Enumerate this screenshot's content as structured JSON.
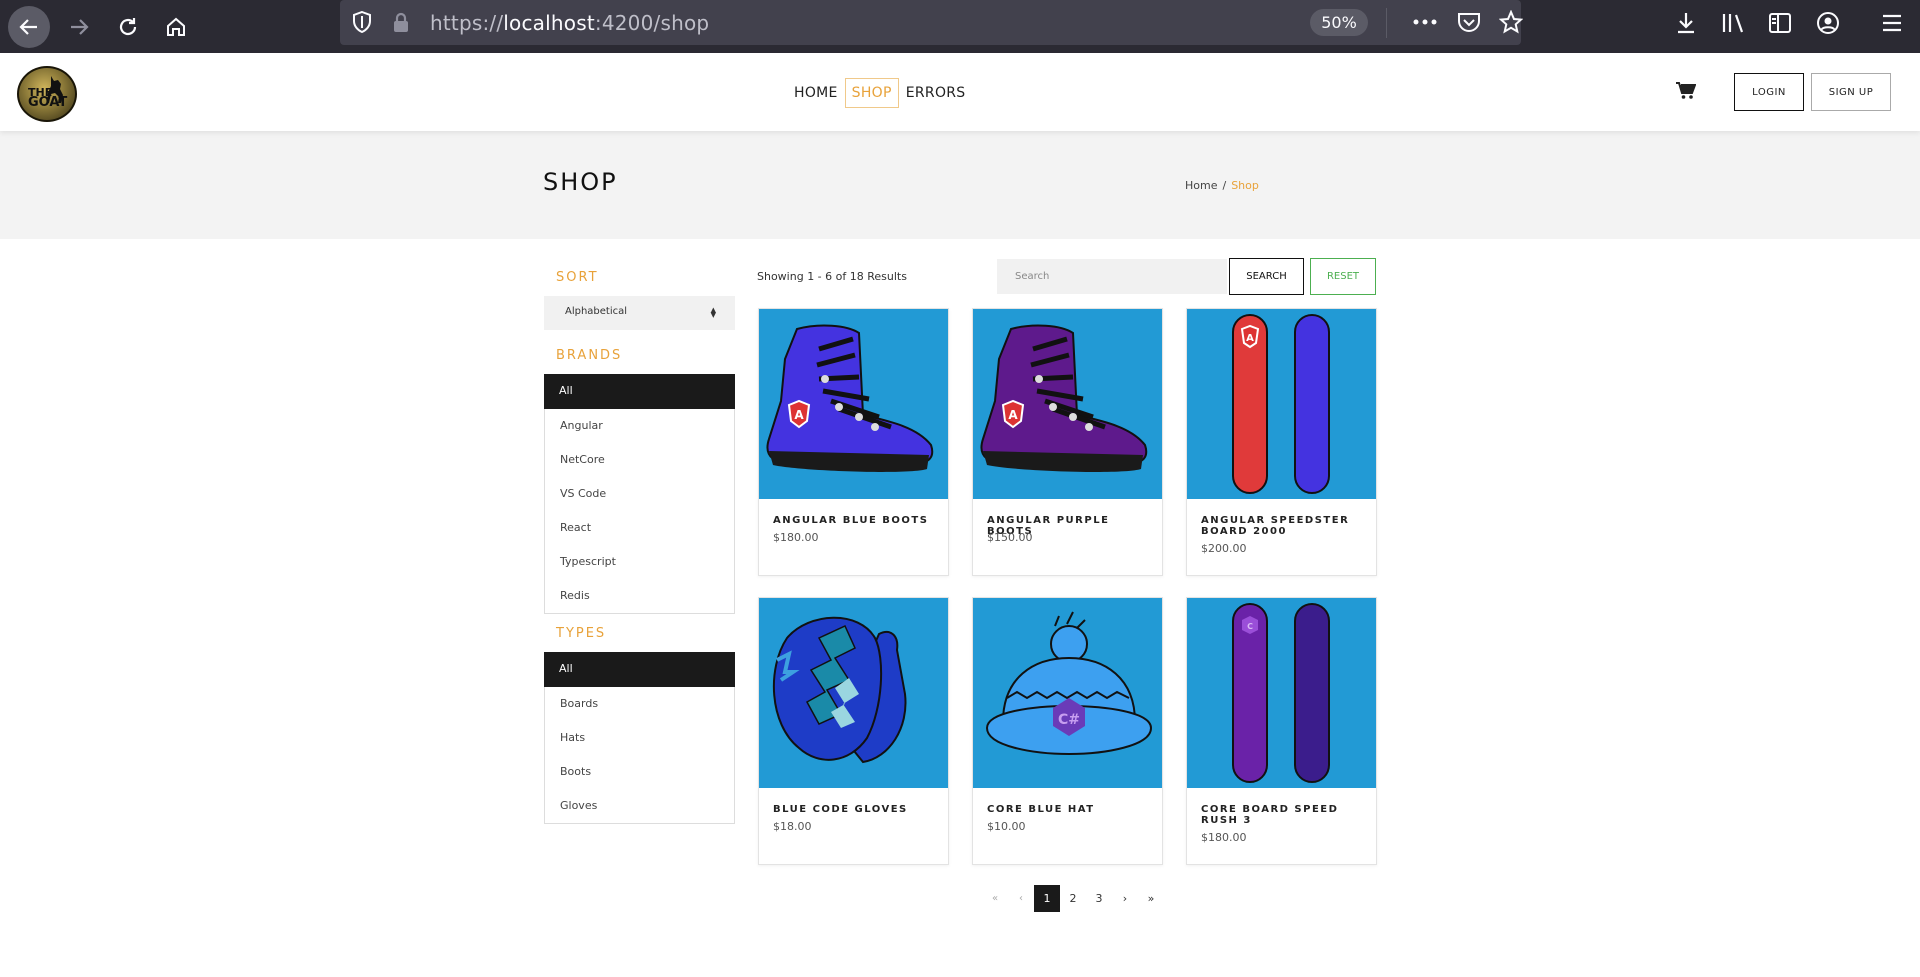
{
  "browser": {
    "url_scheme": "https://",
    "url_host": "localhost",
    "url_rest": ":4200/shop",
    "zoom": "50%"
  },
  "header": {
    "logo_text_line1": "THE",
    "logo_text_line2": "GOAT",
    "nav": [
      {
        "label": "HOME",
        "active": false
      },
      {
        "label": "SHOP",
        "active": true
      },
      {
        "label": "ERRORS",
        "active": false
      }
    ],
    "login_label": "LOGIN",
    "signup_label": "SIGN UP"
  },
  "title_bar": {
    "title": "SHOP",
    "breadcrumb_home": "Home",
    "breadcrumb_sep": "/",
    "breadcrumb_current": "Shop"
  },
  "sidebar": {
    "sort_heading": "SORT",
    "sort_value": "Alphabetical",
    "brands_heading": "BRANDS",
    "brands": [
      "All",
      "Angular",
      "NetCore",
      "VS Code",
      "React",
      "Typescript",
      "Redis"
    ],
    "types_heading": "TYPES",
    "types": [
      "All",
      "Boards",
      "Hats",
      "Boots",
      "Gloves"
    ]
  },
  "results": {
    "count_text": "Showing 1 - 6 of 18 Results",
    "search_placeholder": "Search",
    "search_label": "SEARCH",
    "reset_label": "RESET"
  },
  "products": [
    {
      "name": "ANGULAR BLUE BOOTS",
      "price": "$180.00"
    },
    {
      "name": "ANGULAR PURPLE BOOTS",
      "price": "$150.00"
    },
    {
      "name": "ANGULAR SPEEDSTER BOARD 2000",
      "price": "$200.00"
    },
    {
      "name": "BLUE CODE GLOVES",
      "price": "$18.00"
    },
    {
      "name": "CORE BLUE HAT",
      "price": "$10.00"
    },
    {
      "name": "CORE BOARD SPEED RUSH 3",
      "price": "$180.00"
    }
  ],
  "pagination": {
    "first": "«",
    "prev": "‹",
    "pages": [
      "1",
      "2",
      "3"
    ],
    "current": "1",
    "next": "›",
    "last": "»"
  },
  "colors": {
    "accent": "#e8a23a",
    "product_bg": "#229ad5",
    "reset_green": "#4caf50"
  }
}
